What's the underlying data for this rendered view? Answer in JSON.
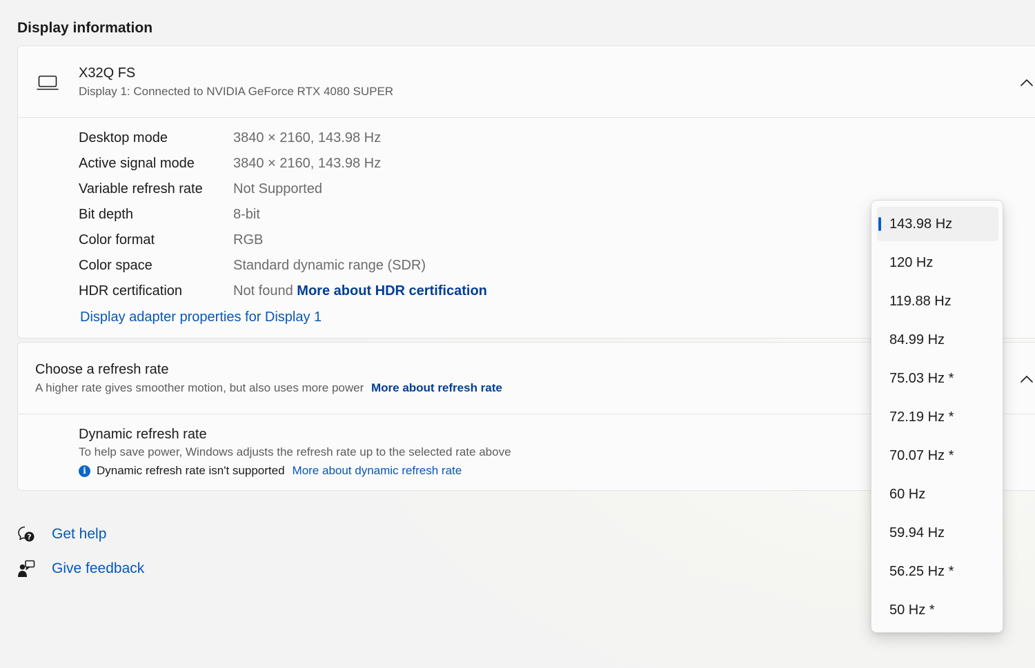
{
  "section_title": "Display information",
  "display": {
    "name": "X32Q FS",
    "subtitle": "Display 1: Connected to NVIDIA GeForce RTX 4080 SUPER",
    "icon": "laptop-icon",
    "expanded": true
  },
  "info_rows": [
    {
      "label": "Desktop mode",
      "value": "3840 × 2160, 143.98 Hz"
    },
    {
      "label": "Active signal mode",
      "value": "3840 × 2160, 143.98 Hz"
    },
    {
      "label": "Variable refresh rate",
      "value": "Not Supported"
    },
    {
      "label": "Bit depth",
      "value": "8-bit"
    },
    {
      "label": "Color format",
      "value": "RGB"
    },
    {
      "label": "Color space",
      "value": "Standard dynamic range (SDR)"
    },
    {
      "label": "HDR certification",
      "value": "Not found",
      "link": "More about HDR certification"
    }
  ],
  "adapter_link": "Display adapter properties for Display 1",
  "refresh": {
    "title": "Choose a refresh rate",
    "subtitle": "A higher rate gives smoother motion, but also uses more power",
    "link": "More about refresh rate",
    "options": [
      "143.98 Hz",
      "120 Hz",
      "119.88 Hz",
      "84.99 Hz",
      "75.03 Hz *",
      "72.19 Hz *",
      "70.07 Hz *",
      "60 Hz",
      "59.94 Hz",
      "56.25 Hz *",
      "50 Hz *"
    ],
    "selected": "143.98 Hz"
  },
  "dynamic": {
    "title": "Dynamic refresh rate",
    "subtitle": "To help save power, Windows adjusts the refresh rate up to the selected rate above",
    "note": "Dynamic refresh rate isn't supported",
    "link": "More about dynamic refresh rate"
  },
  "help": {
    "get_help": "Get help",
    "give_feedback": "Give feedback"
  },
  "colors": {
    "accent": "#0b5fc6",
    "link": "#0757b6",
    "link_bold": "#003e92"
  }
}
